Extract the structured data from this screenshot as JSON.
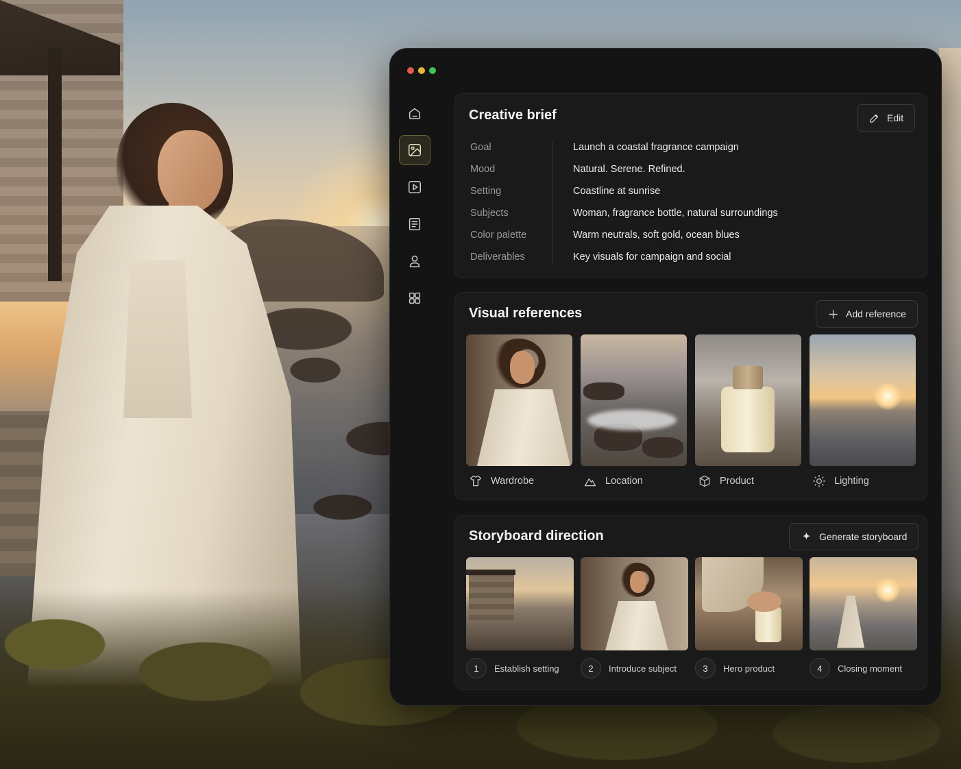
{
  "window": {
    "traffic_lights": {
      "close": "#e35a4d",
      "minimize": "#e8b739",
      "maximize": "#3fc354"
    }
  },
  "sidebar": {
    "items": [
      {
        "icon": "home-icon",
        "active": false
      },
      {
        "icon": "image-icon",
        "active": true
      },
      {
        "icon": "video-icon",
        "active": false
      },
      {
        "icon": "document-icon",
        "active": false
      },
      {
        "icon": "user-icon",
        "active": false
      },
      {
        "icon": "grid-icon",
        "active": false
      }
    ]
  },
  "brief": {
    "title": "Creative brief",
    "edit_label": "Edit",
    "rows": [
      {
        "label": "Goal",
        "value": "Launch a coastal fragrance campaign"
      },
      {
        "label": "Mood",
        "value": "Natural. Serene. Refined."
      },
      {
        "label": "Setting",
        "value": "Coastline at sunrise"
      },
      {
        "label": "Subjects",
        "value": "Woman, fragrance bottle, natural surroundings"
      },
      {
        "label": "Color palette",
        "value": "Warm neutrals, soft gold, ocean blues"
      },
      {
        "label": "Deliverables",
        "value": "Key visuals for campaign and social"
      }
    ]
  },
  "references": {
    "title": "Visual references",
    "add_label": "Add reference",
    "items": [
      {
        "label": "Wardrobe",
        "icon": "shirt-icon"
      },
      {
        "label": "Location",
        "icon": "mountain-icon"
      },
      {
        "label": "Product",
        "icon": "box-icon"
      },
      {
        "label": "Lighting",
        "icon": "sun-icon"
      }
    ]
  },
  "storyboard": {
    "title": "Storyboard direction",
    "generate_label": "Generate storyboard",
    "items": [
      {
        "number": "1",
        "label": "Establish setting"
      },
      {
        "number": "2",
        "label": "Introduce subject"
      },
      {
        "number": "3",
        "label": "Hero product"
      },
      {
        "number": "4",
        "label": "Closing moment"
      }
    ]
  }
}
